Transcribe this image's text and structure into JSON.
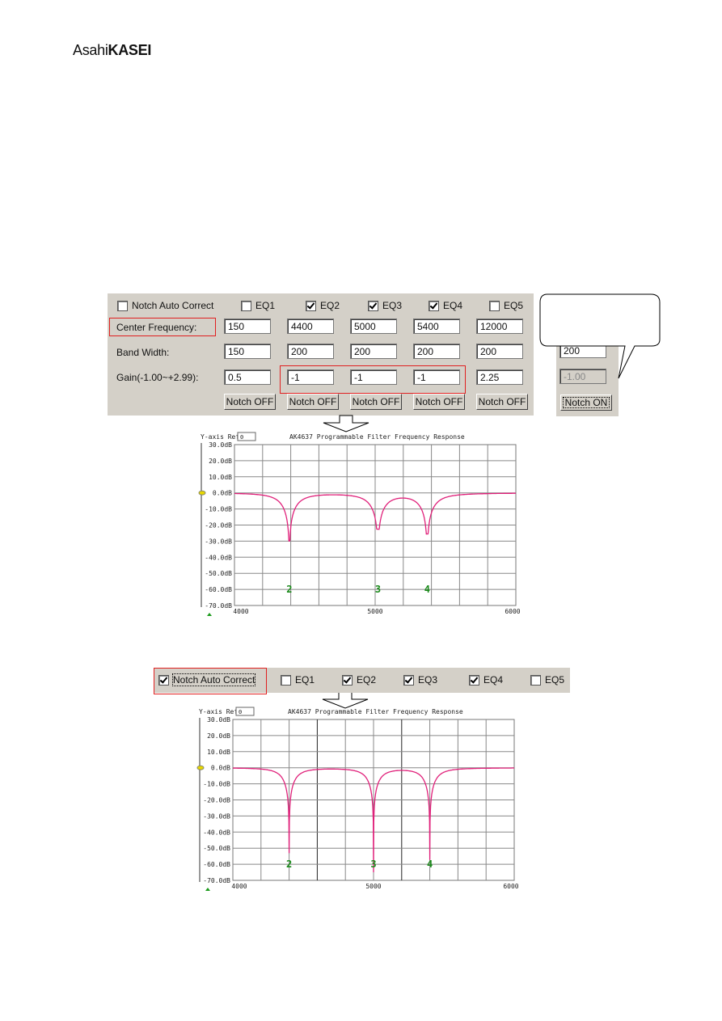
{
  "logo": {
    "brand_light": "Asahi",
    "brand_bold": "KASEI"
  },
  "panel1": {
    "notch_auto_correct": {
      "label": "Notch Auto Correct",
      "checked": false
    },
    "eq": [
      {
        "label": "EQ1",
        "checked": false,
        "center": "150",
        "bandwidth": "150",
        "gain": "0.5",
        "notch": "Notch OFF"
      },
      {
        "label": "EQ2",
        "checked": true,
        "center": "4400",
        "bandwidth": "200",
        "gain": "-1",
        "notch": "Notch OFF"
      },
      {
        "label": "EQ3",
        "checked": true,
        "center": "5000",
        "bandwidth": "200",
        "gain": "-1",
        "notch": "Notch OFF"
      },
      {
        "label": "EQ4",
        "checked": true,
        "center": "5400",
        "bandwidth": "200",
        "gain": "-1",
        "notch": "Notch OFF"
      },
      {
        "label": "EQ5",
        "checked": false,
        "center": "12000",
        "bandwidth": "200",
        "gain": "2.25",
        "notch": "Notch OFF"
      }
    ],
    "row_labels": {
      "center": "Center Frequency:",
      "bandwidth": "Band Width:",
      "gain": "Gain(-1.00~+2.99):"
    }
  },
  "side_panel": {
    "bandwidth": "200",
    "gain": "-1.00",
    "notch": "Notch ON"
  },
  "panel2": {
    "notch_auto_correct": {
      "label": "Notch Auto Correct",
      "checked": true
    },
    "eq": [
      {
        "label": "EQ1",
        "checked": false
      },
      {
        "label": "EQ2",
        "checked": true
      },
      {
        "label": "EQ3",
        "checked": true
      },
      {
        "label": "EQ4",
        "checked": true
      },
      {
        "label": "EQ5",
        "checked": false
      }
    ]
  },
  "colors": {
    "curve": "#e0207a",
    "marker": "#1a8a1a",
    "highlight": "#e02020",
    "panel": "#d4d0c8"
  },
  "chart_data": [
    {
      "type": "line",
      "title": "AK4637 Programmable Filter Frequency Response",
      "yref_label": "Y-axis Ref:",
      "yref_value": "0",
      "xlim": [
        4000,
        6000
      ],
      "ylim": [
        -70,
        30
      ],
      "xticks": [
        "4000",
        "5000",
        "6000"
      ],
      "yticks": [
        "30.0dB",
        "20.0dB",
        "10.0dB",
        "0.0dB",
        "-10.0dB",
        "-20.0dB",
        "-30.0dB",
        "-40.0dB",
        "-50.0dB",
        "-60.0dB",
        "-70.0dB"
      ],
      "grid": true,
      "notches": [
        {
          "marker": "2",
          "freq": 4390,
          "min_db": -30
        },
        {
          "marker": "3",
          "freq": 5020,
          "min_db": -22
        },
        {
          "marker": "4",
          "freq": 5370,
          "min_db": -25
        }
      ]
    },
    {
      "type": "line",
      "title": "AK4637 Programmable Filter Frequency Response",
      "yref_label": "Y-axis Ref:",
      "yref_value": "0",
      "xlim": [
        4000,
        6000
      ],
      "ylim": [
        -70,
        30
      ],
      "xticks": [
        "4000",
        "5000",
        "6000"
      ],
      "yticks": [
        "30.0dB",
        "20.0dB",
        "10.0dB",
        "0.0dB",
        "-10.0dB",
        "-20.0dB",
        "-30.0dB",
        "-40.0dB",
        "-50.0dB",
        "-60.0dB",
        "-70.0dB"
      ],
      "grid": true,
      "notches": [
        {
          "marker": "2",
          "freq": 4400,
          "min_db": -53
        },
        {
          "marker": "3",
          "freq": 5000,
          "min_db": -65
        },
        {
          "marker": "4",
          "freq": 5400,
          "min_db": -57
        }
      ]
    }
  ]
}
